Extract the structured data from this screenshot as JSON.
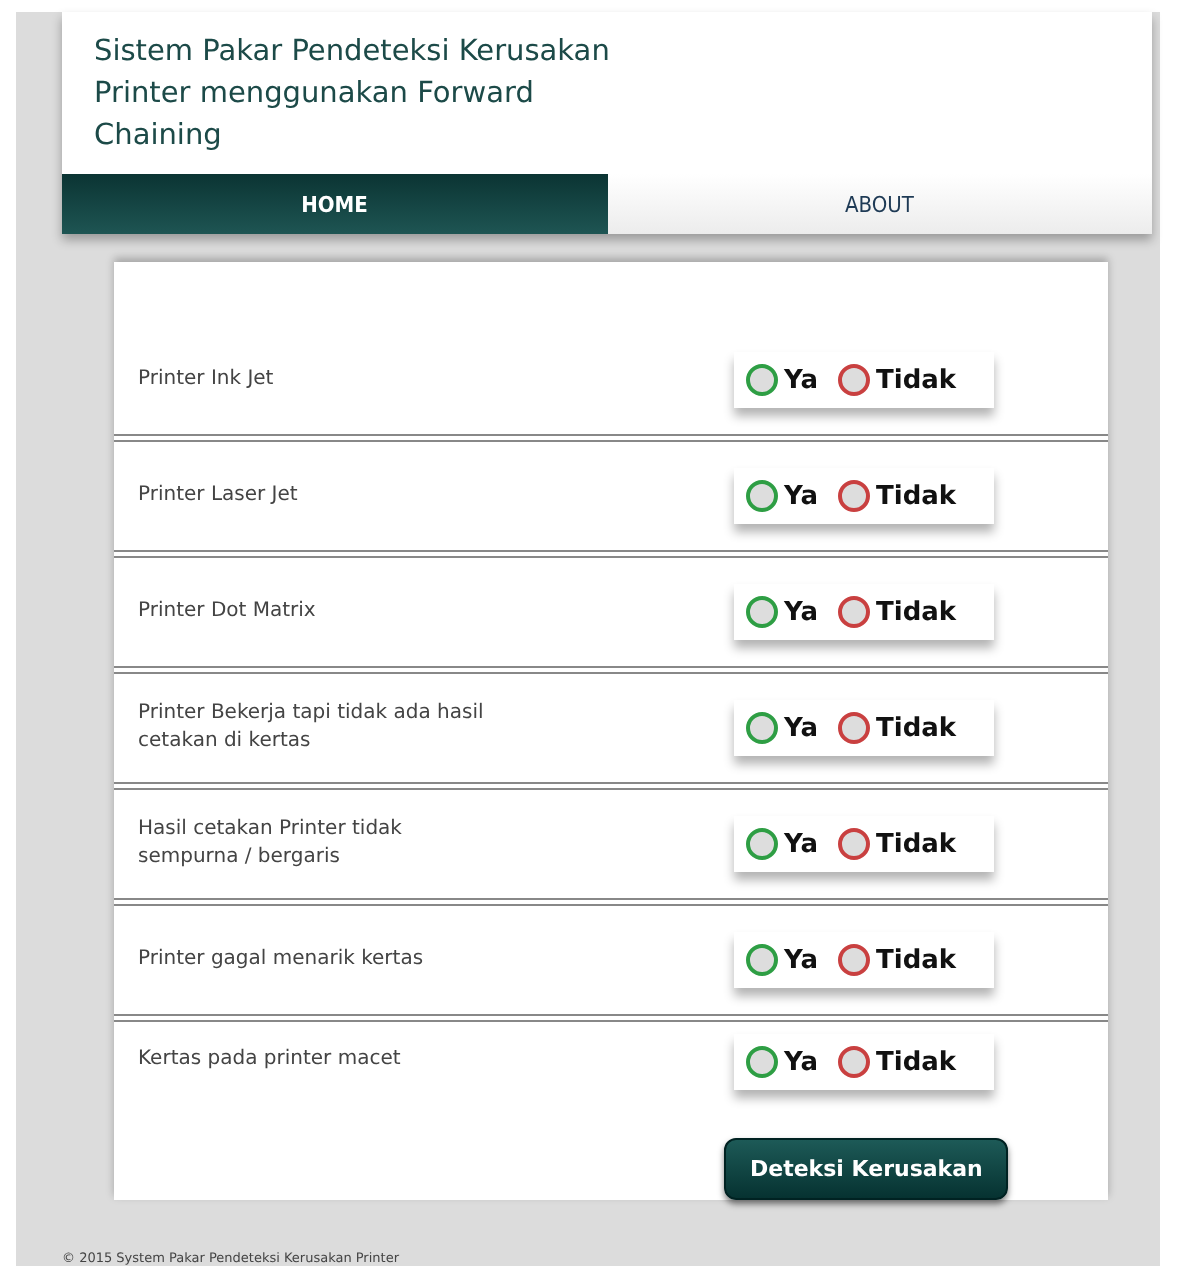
{
  "header": {
    "title": "Sistem Pakar Pendeteksi Kerusakan Printer menggunakan Forward Chaining"
  },
  "tabs": [
    {
      "label": "HOME",
      "selected": true
    },
    {
      "label": "ABOUT",
      "selected": false
    }
  ],
  "questions": [
    {
      "label": "Printer Ink Jet",
      "options": [
        {
          "label": "Ya",
          "selected": false,
          "color": "#2e9e44"
        },
        {
          "label": "Tidak",
          "selected": false,
          "color": "#c94040"
        }
      ]
    },
    {
      "label": "Printer Laser Jet",
      "options": [
        {
          "label": "Ya",
          "selected": false,
          "color": "#2e9e44"
        },
        {
          "label": "Tidak",
          "selected": false,
          "color": "#c94040"
        }
      ]
    },
    {
      "label": "Printer Dot Matrix",
      "options": [
        {
          "label": "Ya",
          "selected": false,
          "color": "#2e9e44"
        },
        {
          "label": "Tidak",
          "selected": false,
          "color": "#c94040"
        }
      ]
    },
    {
      "label": "Printer Bekerja tapi tidak ada hasil cetakan di kertas",
      "options": [
        {
          "label": "Ya",
          "selected": false,
          "color": "#2e9e44"
        },
        {
          "label": "Tidak",
          "selected": false,
          "color": "#c94040"
        }
      ]
    },
    {
      "label": "Hasil cetakan Printer tidak sempurna / bergaris",
      "options": [
        {
          "label": "Ya",
          "selected": false,
          "color": "#2e9e44"
        },
        {
          "label": "Tidak",
          "selected": false,
          "color": "#c94040"
        }
      ]
    },
    {
      "label": "Printer gagal menarik kertas",
      "options": [
        {
          "label": "Ya",
          "selected": false,
          "color": "#2e9e44"
        },
        {
          "label": "Tidak",
          "selected": false,
          "color": "#c94040"
        }
      ]
    },
    {
      "label": "Kertas pada printer macet",
      "options": [
        {
          "label": "Ya",
          "selected": false,
          "color": "#2e9e44"
        },
        {
          "label": "Tidak",
          "selected": false,
          "color": "#c94040"
        }
      ]
    }
  ],
  "submit_button": "Deteksi Kerusakan",
  "footer": "© 2015 System Pakar Pendeteksi Kerusakan Printer"
}
